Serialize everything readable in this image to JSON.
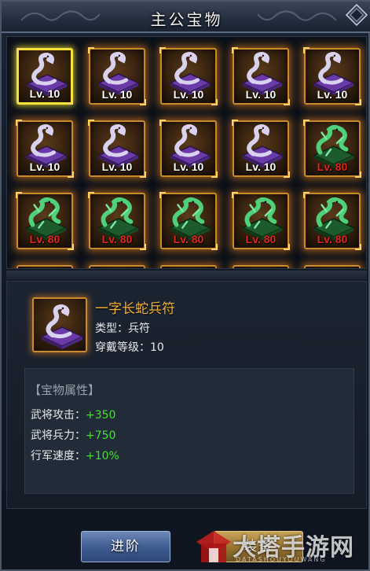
{
  "window": {
    "title": "主公宝物"
  },
  "grid": {
    "items": [
      {
        "level": "Lv. 10",
        "kind": "snake",
        "selected": true
      },
      {
        "level": "Lv. 10",
        "kind": "snake"
      },
      {
        "level": "Lv. 10",
        "kind": "snake"
      },
      {
        "level": "Lv. 10",
        "kind": "snake"
      },
      {
        "level": "Lv. 10",
        "kind": "snake"
      },
      {
        "level": "Lv. 10",
        "kind": "snake"
      },
      {
        "level": "Lv. 10",
        "kind": "snake"
      },
      {
        "level": "Lv. 10",
        "kind": "snake"
      },
      {
        "level": "Lv. 10",
        "kind": "snake"
      },
      {
        "level": "Lv. 80",
        "kind": "dragon"
      },
      {
        "level": "Lv. 80",
        "kind": "dragon"
      },
      {
        "level": "Lv. 80",
        "kind": "dragon"
      },
      {
        "level": "Lv. 80",
        "kind": "dragon"
      },
      {
        "level": "Lv. 80",
        "kind": "dragon"
      },
      {
        "level": "Lv. 80",
        "kind": "dragon"
      }
    ]
  },
  "detail": {
    "name": "一字长蛇兵符",
    "type_text": "类型：兵符",
    "level_text": "穿戴等级：10"
  },
  "attributes": {
    "title": "【宝物属性】",
    "rows": [
      {
        "key": "武将攻击：",
        "value": "+350"
      },
      {
        "key": "武将兵力：",
        "value": "+750"
      },
      {
        "key": "行军速度：",
        "value": "+10%"
      }
    ]
  },
  "buttons": {
    "advance": "进阶",
    "equip": "装备"
  },
  "watermark": {
    "text": "大塔手游网",
    "sub": "DATASHOUYOUWANG"
  },
  "colors": {
    "frame_glow": "#ff8c1e",
    "selected_border": "#f5e23a",
    "name_gold": "#f3b230",
    "value_green": "#43e22e",
    "level_red": "#e0281c"
  }
}
